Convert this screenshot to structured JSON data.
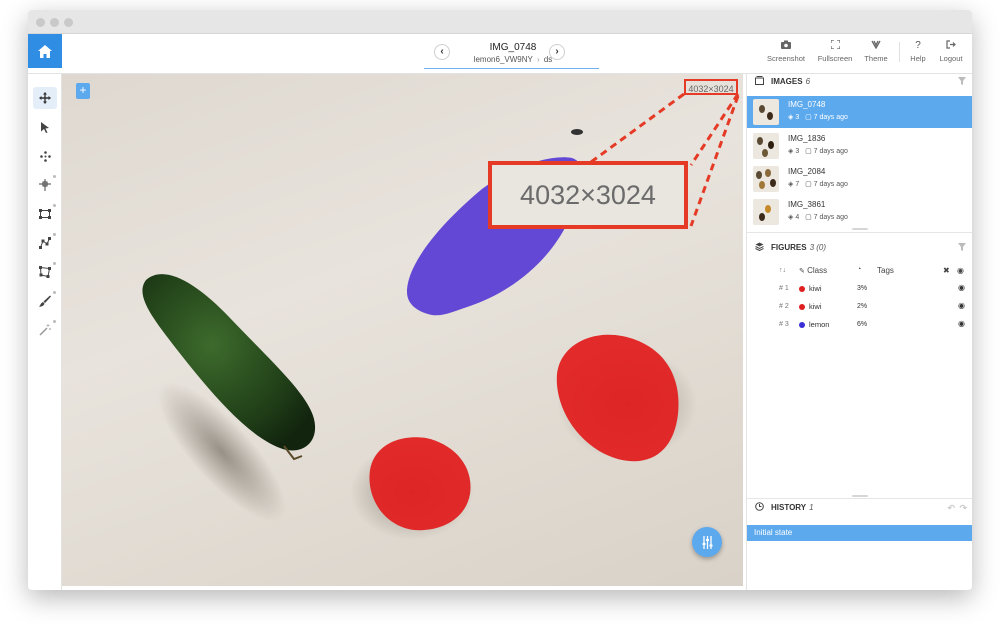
{
  "header": {
    "image_title": "IMG_0748",
    "breadcrumb_project": "lemon6_VW9NY",
    "breadcrumb_sep": "›",
    "breadcrumb_dataset": "ds",
    "prev_label": "‹",
    "next_label": "›"
  },
  "toolbar_buttons": {
    "screenshot": "Screenshot",
    "fullscreen": "Fullscreen",
    "theme": "Theme",
    "help": "Help",
    "logout": "Logout"
  },
  "canvas": {
    "resolution_label": "4032×3024",
    "resolution_zoom": "4032×3024",
    "add_label": "+",
    "annotation_colors": {
      "kiwi": "#e02020",
      "lemon": "#5b3fd4"
    }
  },
  "images": {
    "title": "IMAGES",
    "count": "6",
    "items": [
      {
        "name": "IMG_0748",
        "objects": "3",
        "date": "7 days ago"
      },
      {
        "name": "IMG_1836",
        "objects": "3",
        "date": "7 days ago"
      },
      {
        "name": "IMG_2084",
        "objects": "7",
        "date": "7 days ago"
      },
      {
        "name": "IMG_3861",
        "objects": "4",
        "date": "7 days ago"
      }
    ]
  },
  "figures": {
    "title": "FIGURES",
    "count": "3 (0)",
    "col_class": "Class",
    "col_tags": "Tags",
    "rows": [
      {
        "num": "# 1",
        "class": "kiwi",
        "area": "3%",
        "color": "#e02020"
      },
      {
        "num": "# 2",
        "class": "kiwi",
        "area": "2%",
        "color": "#e02020"
      },
      {
        "num": "# 3",
        "class": "lemon",
        "area": "6%",
        "color": "#3a2fd4"
      }
    ]
  },
  "history": {
    "title": "HISTORY",
    "count": "1",
    "items": [
      "Initial state"
    ]
  },
  "colors": {
    "accent": "#2f8de4",
    "highlight": "#5da9ee",
    "callout": "#e53a26"
  }
}
